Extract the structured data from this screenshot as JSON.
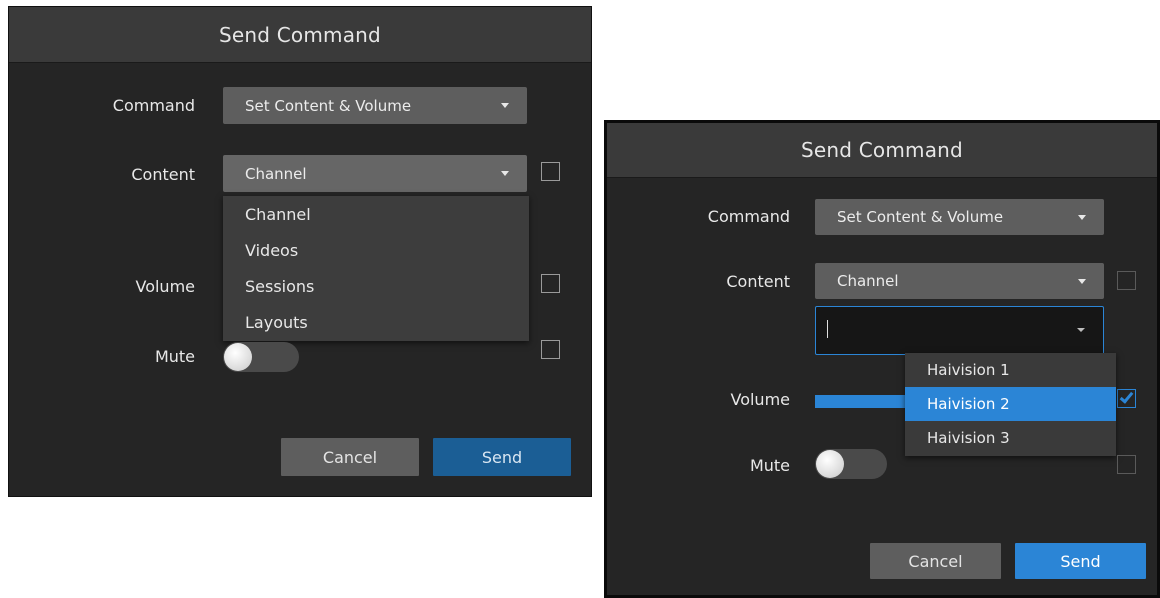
{
  "left_dialog": {
    "title": "Send Command",
    "command_label": "Command",
    "command_value": "Set Content & Volume",
    "content_label": "Content",
    "content_value": "Channel",
    "content_options": [
      "Channel",
      "Videos",
      "Sessions",
      "Layouts"
    ],
    "volume_label": "Volume",
    "mute_label": "Mute",
    "mute_on": false,
    "cancel_label": "Cancel",
    "send_label": "Send"
  },
  "right_dialog": {
    "title": "Send Command",
    "command_label": "Command",
    "command_value": "Set Content & Volume",
    "content_label": "Content",
    "content_value": "Channel",
    "channel_input_value": "",
    "channel_options": [
      "Haivision 1",
      "Haivision 2",
      "Haivision 3"
    ],
    "highlighted_option": "Haivision 2",
    "volume_label": "Volume",
    "volume_checked": true,
    "mute_label": "Mute",
    "mute_on": false,
    "cancel_label": "Cancel",
    "send_label": "Send"
  },
  "colors": {
    "accent": "#2b85d6",
    "dialog_bg": "#252525",
    "titlebar_bg": "#3a3a3a",
    "control_bg": "#5e5e5e"
  }
}
